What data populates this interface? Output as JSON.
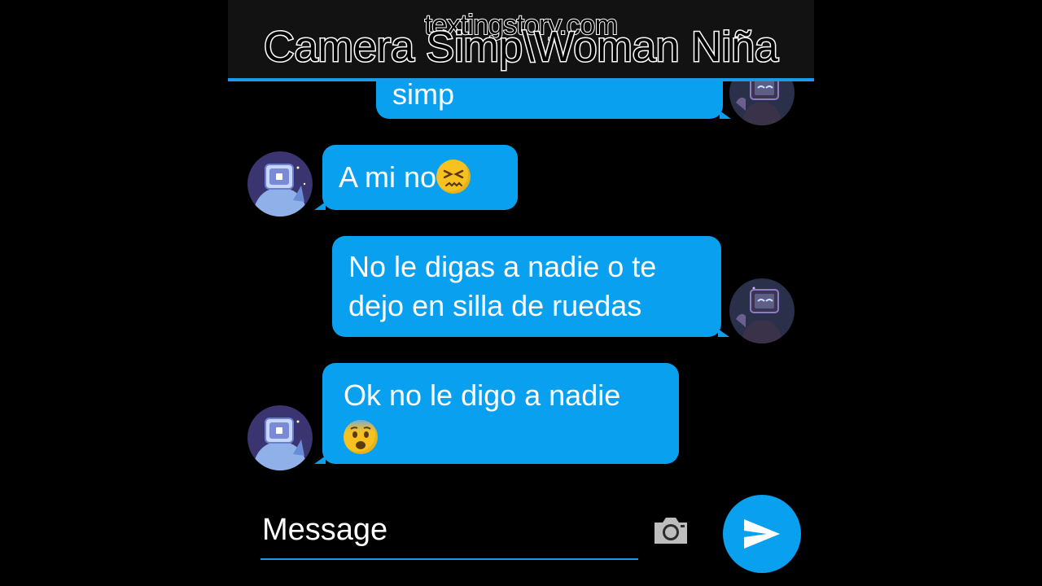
{
  "header": {
    "watermark": "textingstory.com",
    "title": "Camera Simp\\Woman Niña"
  },
  "messages": [
    {
      "side": "sent",
      "lines": [
        "simp"
      ],
      "emoji": null
    },
    {
      "side": "received",
      "lines": [
        "A mi no"
      ],
      "emoji": "confounded-face"
    },
    {
      "side": "sent",
      "lines": [
        "No le digas a nadie o te",
        "dejo en silla de ruedas"
      ],
      "emoji": null
    },
    {
      "side": "received",
      "lines": [
        "Ok no le digo a nadie"
      ],
      "emoji": "anxious-face"
    }
  ],
  "composer": {
    "placeholder": "Message",
    "camera_icon": "camera-icon",
    "send_icon": "send-icon"
  },
  "colors": {
    "bubble": "#0aa0f0",
    "accent": "#1a9be8",
    "background": "#000000",
    "header": "#121212"
  }
}
